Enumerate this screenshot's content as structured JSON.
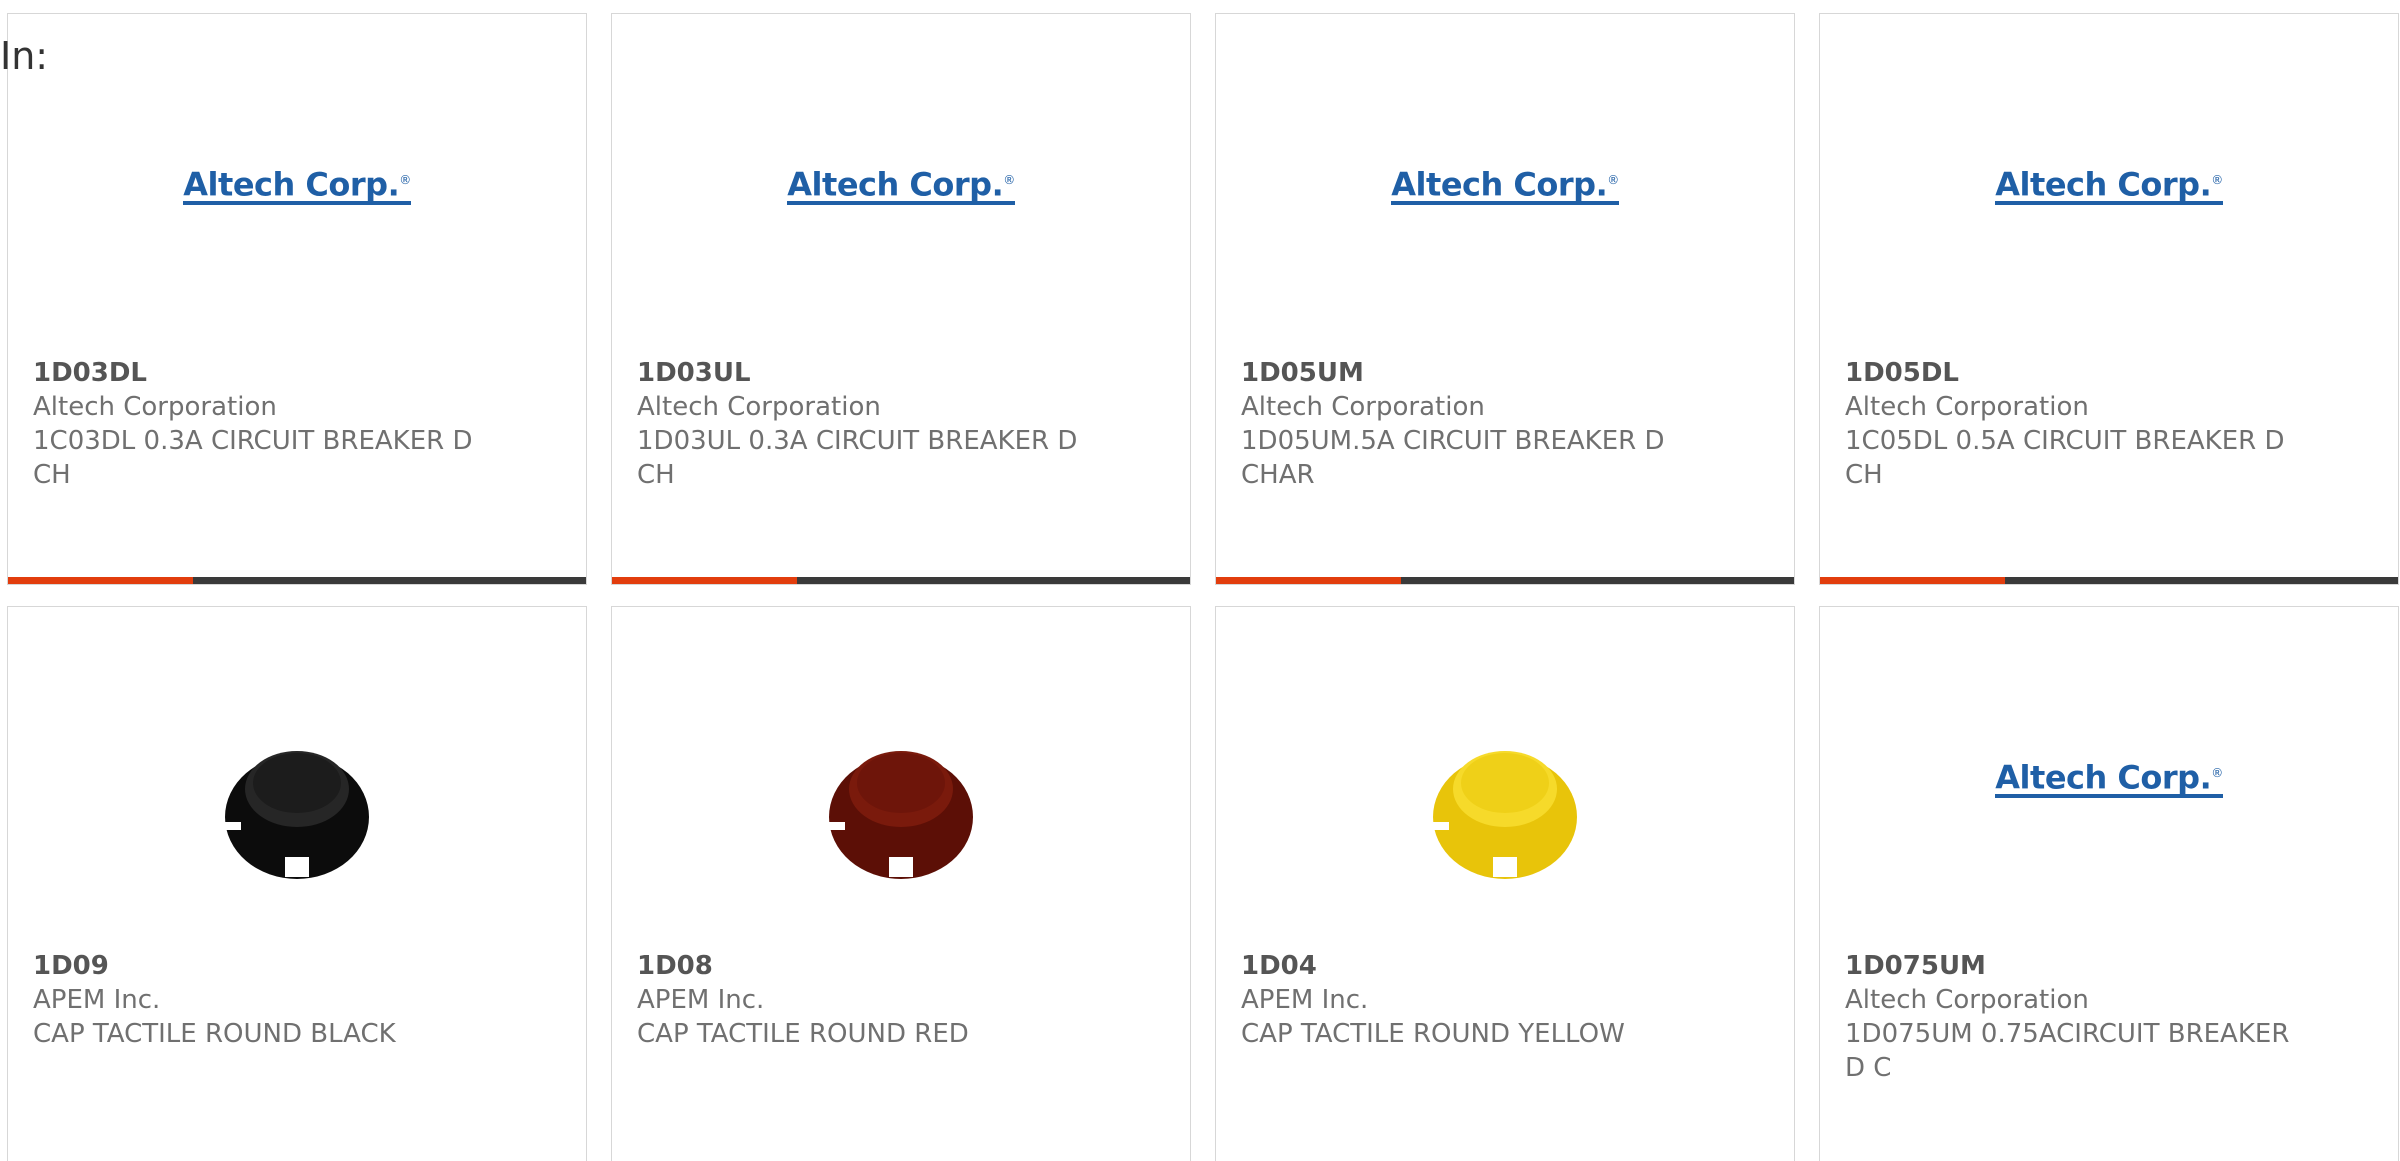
{
  "header": {
    "in_label": "In:"
  },
  "logo": {
    "text": "Altech Corp.",
    "reg": "®"
  },
  "products": [
    {
      "part": "1D03DL",
      "maker": "Altech Corporation",
      "desc": "1C03DL 0.3A CIRCUIT BREAKER D CH",
      "image": "altech-logo",
      "progress": 0.32
    },
    {
      "part": "1D03UL",
      "maker": "Altech Corporation",
      "desc": "1D03UL 0.3A CIRCUIT BREAKER D CH",
      "image": "altech-logo",
      "progress": 0.32
    },
    {
      "part": "1D05UM",
      "maker": "Altech Corporation",
      "desc": "1D05UM.5A CIRCUIT BREAKER D CHAR",
      "image": "altech-logo",
      "progress": 0.32
    },
    {
      "part": "1D05DL",
      "maker": "Altech Corporation",
      "desc": "1C05DL 0.5A CIRCUIT BREAKER D CH",
      "image": "altech-logo",
      "progress": 0.32
    },
    {
      "part": "1D09",
      "maker": "APEM Inc.",
      "desc": "CAP TACTILE ROUND BLACK",
      "image": "cap-black",
      "color": "#141414"
    },
    {
      "part": "1D08",
      "maker": "APEM Inc.",
      "desc": "CAP TACTILE ROUND RED",
      "image": "cap-red",
      "color": "#6a1208"
    },
    {
      "part": "1D04",
      "maker": "APEM Inc.",
      "desc": "CAP TACTILE ROUND YELLOW",
      "image": "cap-yellow",
      "color": "#f0cf10"
    },
    {
      "part": "1D075UM",
      "maker": "Altech Corporation",
      "desc": "1D075UM 0.75ACIRCUIT BREAKER D C",
      "image": "altech-logo"
    }
  ],
  "colors": {
    "accent": "#e23d0d",
    "bar": "#3a3a3a",
    "logo": "#1f5fa6",
    "text": "#707070"
  }
}
